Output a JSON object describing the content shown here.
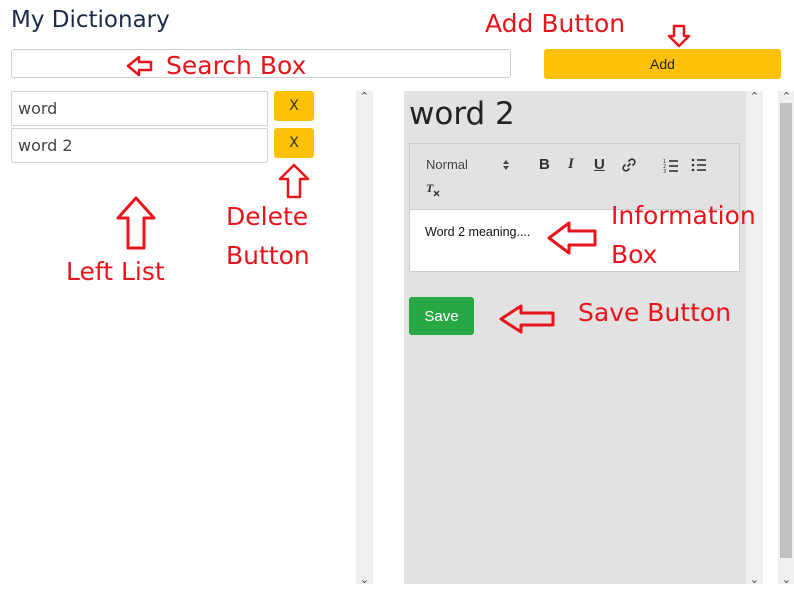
{
  "app": {
    "title": "My Dictionary"
  },
  "search": {
    "placeholder": "",
    "value": ""
  },
  "add_button": {
    "label": "Add"
  },
  "left_list": {
    "items": [
      {
        "label": "word",
        "delete_label": "X"
      },
      {
        "label": "word 2",
        "delete_label": "X"
      }
    ]
  },
  "editor": {
    "title": "word 2",
    "toolbar": {
      "format_select": "Normal",
      "bold": "B",
      "italic": "I",
      "underline": "U",
      "link_icon": "link-icon",
      "ordered_list_icon": "ordered-list-icon",
      "bullet_list_icon": "bullet-list-icon",
      "clean_icon": "clear-format-icon"
    },
    "content": "Word 2 meaning....",
    "save_label": "Save"
  },
  "annotations": {
    "add_button": "Add Button",
    "search_box": "Search Box",
    "left_list": "Left List",
    "delete_button_1": "Delete",
    "delete_button_2": "Button",
    "information_box_1": "Information",
    "information_box_2": "Box",
    "save_button": "Save Button"
  },
  "colors": {
    "accent_yellow": "#ffc107",
    "save_green": "#28a745",
    "annotation_red": "#e8141c",
    "editor_background": "#e2e2e2"
  }
}
